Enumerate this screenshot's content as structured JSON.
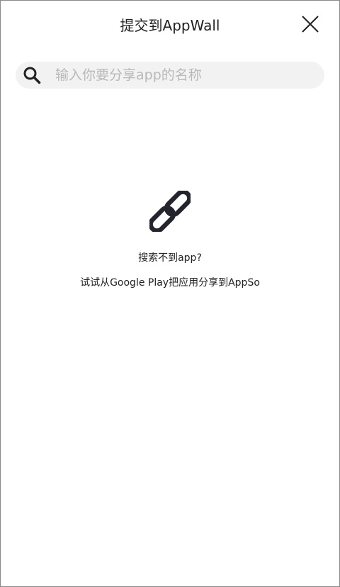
{
  "header": {
    "title": "提交到AppWall",
    "close_icon": "close-icon"
  },
  "search": {
    "icon": "search-icon",
    "value": "",
    "placeholder": "输入你要分享app的名称"
  },
  "empty_state": {
    "icon": "link-icon",
    "title": "搜索不到app?",
    "hint": "试试从Google Play把应用分享到AppSo"
  },
  "colors": {
    "background": "#ffffff",
    "search_background": "#f2f2f2",
    "placeholder": "#b9b9b9",
    "text": "#222222",
    "icon": "#24242e"
  }
}
